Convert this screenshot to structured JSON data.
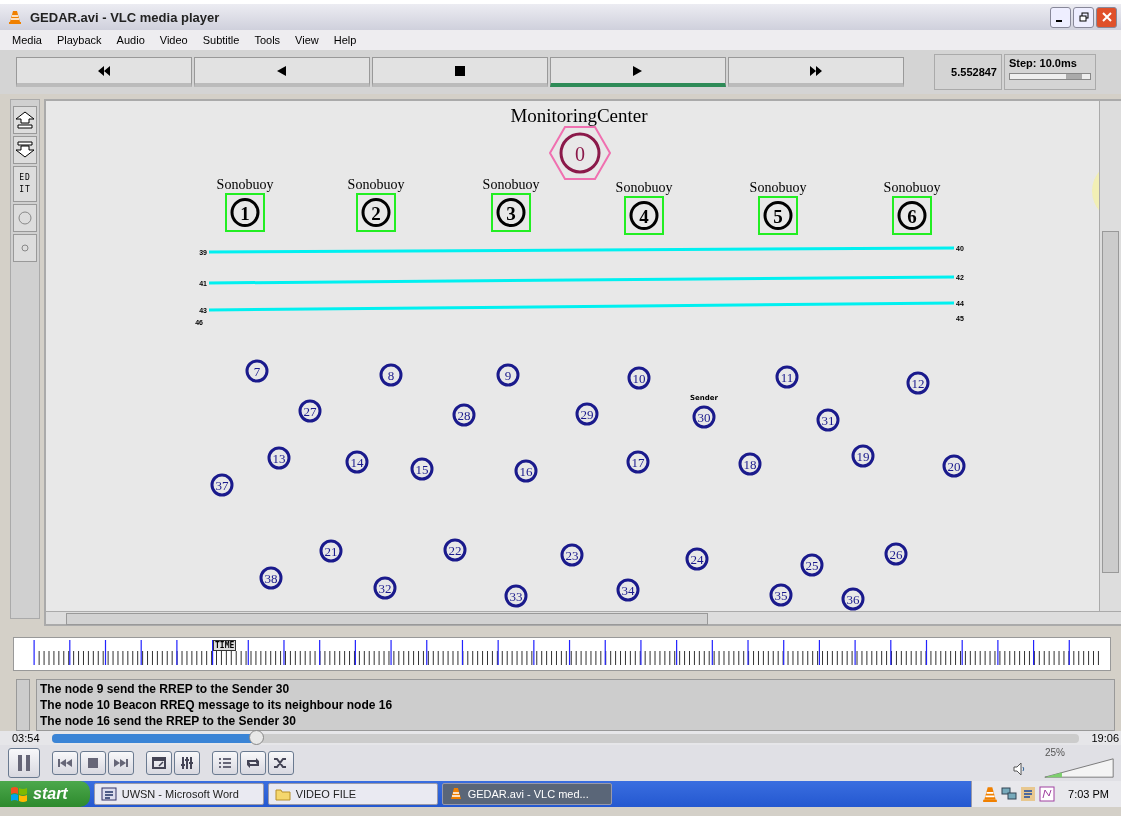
{
  "window": {
    "title": "GEDAR.avi - VLC media player"
  },
  "menu": [
    "Media",
    "Playback",
    "Audio",
    "Video",
    "Subtitle",
    "Tools",
    "View",
    "Help"
  ],
  "transport": {
    "buttons": [
      {
        "selected": false
      },
      {
        "selected": false
      },
      {
        "selected": false
      },
      {
        "selected": true
      },
      {
        "selected": false
      }
    ],
    "time": "5.552847",
    "step": {
      "label": "Step: 10.0ms",
      "level": 0.8
    }
  },
  "tools": {
    "edit": "EDIT"
  },
  "canvas": {
    "title": "MonitoringCenter",
    "center_node": "0",
    "sonobuoys": [
      {
        "label": "Sonobuoy",
        "number": "1"
      },
      {
        "label": "Sonobuoy",
        "number": "2"
      },
      {
        "label": "Sonobuoy",
        "number": "3"
      },
      {
        "label": "Sonobuoy",
        "number": "4"
      },
      {
        "label": "Sonobuoy",
        "number": "5"
      },
      {
        "label": "Sonobuoy",
        "number": "6"
      }
    ],
    "links": [
      {
        "start": "39",
        "end": "40"
      },
      {
        "start": "41",
        "end": "42"
      },
      {
        "start": "43",
        "end": "44"
      }
    ],
    "loose_labels": [
      "46",
      "45"
    ],
    "nodes": [
      {
        "number": "7"
      },
      {
        "number": "8"
      },
      {
        "number": "9"
      },
      {
        "number": "10"
      },
      {
        "number": "11"
      },
      {
        "number": "12"
      },
      {
        "number": "27"
      },
      {
        "number": "28"
      },
      {
        "number": "29"
      },
      {
        "number": "30",
        "tag": "Sender"
      },
      {
        "number": "31"
      },
      {
        "number": "13"
      },
      {
        "number": "14"
      },
      {
        "number": "15"
      },
      {
        "number": "16"
      },
      {
        "number": "17"
      },
      {
        "number": "18"
      },
      {
        "number": "19"
      },
      {
        "number": "20"
      },
      {
        "number": "37"
      },
      {
        "number": "21"
      },
      {
        "number": "22"
      },
      {
        "number": "23"
      },
      {
        "number": "24"
      },
      {
        "number": "25"
      },
      {
        "number": "26"
      },
      {
        "number": "38"
      },
      {
        "number": "32"
      },
      {
        "number": "33"
      },
      {
        "number": "34"
      },
      {
        "number": "35"
      },
      {
        "number": "36"
      }
    ]
  },
  "timeline": {
    "marker": "TIME"
  },
  "log": [
    "The node 9 send the RREP to the Sender 30",
    "The node 10 Beacon RREQ message to its neighbour node 16",
    "The node 16 send the RREP to the Sender 30"
  ],
  "player": {
    "elapsed": "03:54",
    "total": "19:06",
    "progress": {
      "level": 0.2
    },
    "volume": {
      "label": "25%",
      "level": 0.25
    }
  },
  "taskbar": {
    "start": "start",
    "tasks": [
      {
        "label": "UWSN - Microsoft Word",
        "selected": false
      },
      {
        "label": "VIDEO FILE",
        "selected": false
      },
      {
        "label": "GEDAR.avi - VLC med...",
        "selected": true
      }
    ],
    "clock": "7:03 PM"
  }
}
